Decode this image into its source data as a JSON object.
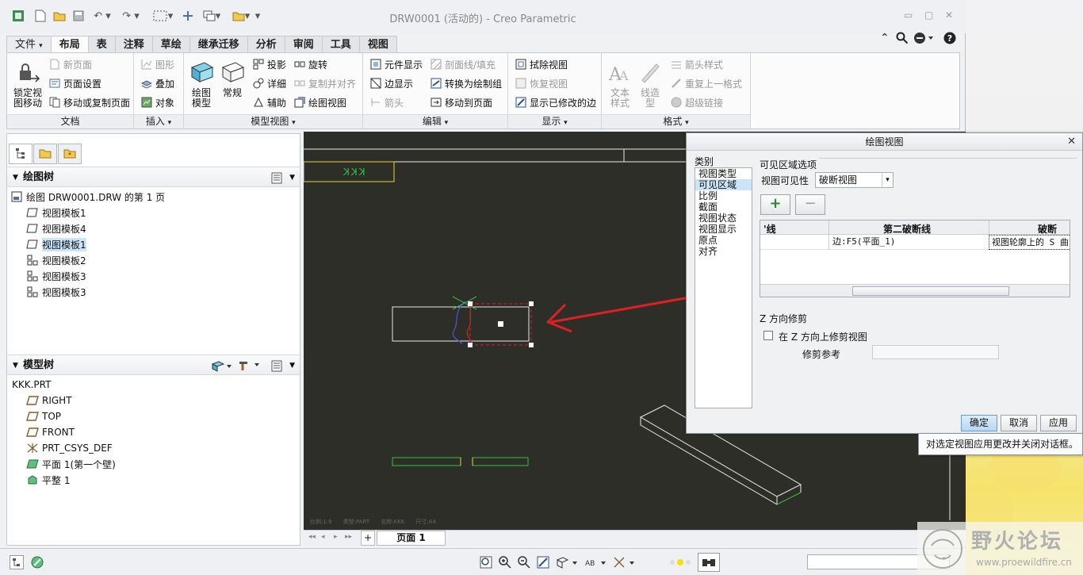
{
  "window": {
    "title": "DRW0001 (活动的) - Creo Parametric",
    "controls": [
      "▭",
      "▢",
      "✕"
    ]
  },
  "ribbon_tabs": [
    {
      "label": "文件",
      "arrow": "▾"
    },
    {
      "label": "布局"
    },
    {
      "label": "表"
    },
    {
      "label": "注释"
    },
    {
      "label": "草绘"
    },
    {
      "label": "继承迁移"
    },
    {
      "label": "分析"
    },
    {
      "label": "审阅"
    },
    {
      "label": "工具"
    },
    {
      "label": "视图"
    }
  ],
  "ribbon": {
    "doc": {
      "label": "文档",
      "lock_view": "锁定视图移动",
      "new_page": "新页面",
      "page_setup": "页面设置",
      "move_copy_page": "移动或复制页面"
    },
    "insert": {
      "label": "插入",
      "graph": "图形",
      "overlay": "叠加",
      "object": "对象"
    },
    "model_view": {
      "label": "模型视图",
      "drawing_model": "绘图模型",
      "general": "常规",
      "projection": "投影",
      "detail": "详细",
      "auxiliary": "辅助",
      "rotate": "旋转",
      "copy_align": "复制并对齐",
      "drawing_view": "绘图视图"
    },
    "edit": {
      "label": "编辑",
      "component_display": "元件显示",
      "edge_display": "边显示",
      "arrow": "箭头",
      "section_fill": "剖面线/填充",
      "convert_group": "转换为绘制组",
      "move_to_page": "移动到页面"
    },
    "display": {
      "label": "显示",
      "erase_view": "拭除视图",
      "resume_view": "恢复视图",
      "show_modified_edges": "显示已修改的边"
    },
    "format": {
      "label": "格式",
      "text_style": "文本样式",
      "line_style": "线造型",
      "arrow_style": "箭头样式",
      "repeat_format": "重复上一格式",
      "hyperlink": "超级链接"
    },
    "group_arrow": "▾"
  },
  "drawing_tree": {
    "header": "绘图树",
    "root": "绘图 DRW0001.DRW 的第 1 页",
    "items": [
      "视图模板1",
      "视图模板4",
      "视图模板1",
      "视图模板2",
      "视图模板3",
      "视图模板3"
    ]
  },
  "model_tree": {
    "header": "模型树",
    "root": "KKK.PRT",
    "items": [
      "RIGHT",
      "TOP",
      "FRONT",
      "PRT_CSYS_DEF",
      "平面 1(第一个壁)",
      "平整 1"
    ]
  },
  "graphics": {
    "title_block_text": "KKK",
    "footer": [
      "比例:1:9",
      "类型:PART",
      "名称:KKK",
      "尺寸:A4"
    ]
  },
  "page_bar": {
    "nav": [
      "◂◂",
      "◂",
      "▸",
      "▸▸"
    ],
    "add": "+",
    "page_label": "页面 1"
  },
  "dialog": {
    "title": "绘图视图",
    "close": "✕",
    "category_label": "类别",
    "categories": [
      "视图类型",
      "可见区域",
      "比例",
      "截面",
      "视图状态",
      "视图显示",
      "原点",
      "对齐"
    ],
    "selected_category": 1,
    "section_title": "可见区域选项",
    "visibility_label": "视图可见性",
    "visibility_value": "破断视图",
    "add_btn": "+",
    "remove_btn": "−",
    "table_headers": [
      "'线",
      "第二破断线",
      "破断"
    ],
    "table_row": [
      "",
      "边:F5(平面_1)",
      "视图轮廓上的 S 曲"
    ],
    "z_section": "Z 方向修剪",
    "z_checkbox": "在 Z 方向上修剪视图",
    "trim_ref_label": "修剪参考",
    "ok": "确定",
    "cancel": "取消",
    "apply": "应用",
    "dropdown_arrow": "▾"
  },
  "tooltip": "对选定视图应用更改并关闭对话框。",
  "watermark": {
    "name": "野火论坛",
    "url": "www.proewildfire.cn"
  },
  "colors": {
    "graphics_bg": "#2e2e29",
    "selected_bg": "#cce4f7",
    "annotation_red": "#e02020",
    "yellow_line": "#e5d63a",
    "green_line": "#2ec040"
  }
}
